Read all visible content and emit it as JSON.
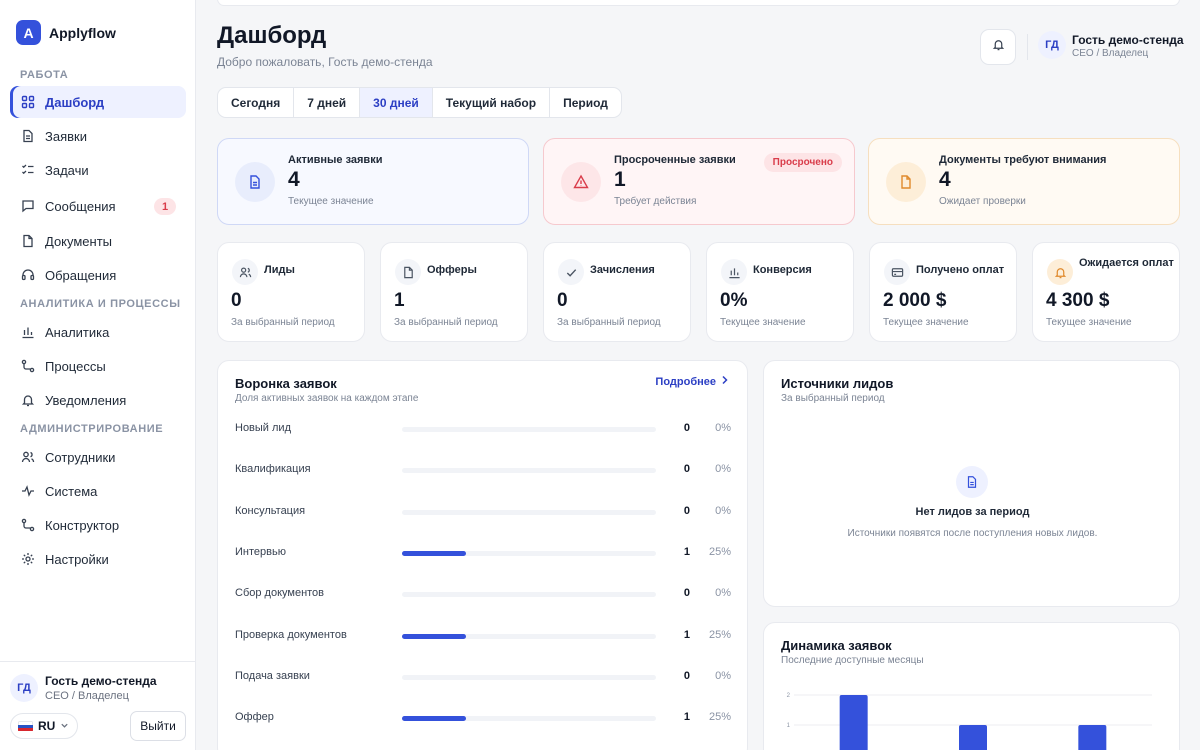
{
  "brand": {
    "logo_letter": "A",
    "name": "Applyflow"
  },
  "sidebar": {
    "sections": [
      {
        "title": "РАБОТА",
        "items": [
          {
            "label": "Дашборд",
            "icon": "grid-icon",
            "active": true
          },
          {
            "label": "Заявки",
            "icon": "file-icon"
          },
          {
            "label": "Задачи",
            "icon": "checklist-icon"
          },
          {
            "label": "Сообщения",
            "icon": "message-icon",
            "badge": "1"
          },
          {
            "label": "Документы",
            "icon": "document-icon"
          },
          {
            "label": "Обращения",
            "icon": "headset-icon"
          }
        ]
      },
      {
        "title": "АНАЛИТИКА И ПРОЦЕССЫ",
        "items": [
          {
            "label": "Аналитика",
            "icon": "bar-chart-icon"
          },
          {
            "label": "Процессы",
            "icon": "workflow-icon"
          },
          {
            "label": "Уведомления",
            "icon": "bell-icon"
          }
        ]
      },
      {
        "title": "АДМИНИСТРИРОВАНИЕ",
        "items": [
          {
            "label": "Сотрудники",
            "icon": "users-icon"
          },
          {
            "label": "Система",
            "icon": "activity-icon"
          },
          {
            "label": "Конструктор",
            "icon": "workflow-icon"
          },
          {
            "label": "Настройки",
            "icon": "gear-icon"
          }
        ]
      }
    ],
    "footer": {
      "avatar": "ГД",
      "name": "Гость демо-стенда",
      "role": "CEO / Владелец",
      "language": "RU",
      "logout": "Выйти"
    }
  },
  "header": {
    "title": "Дашборд",
    "subtitle": "Добро пожаловать, Гость демо-стенда",
    "user_avatar": "ГД",
    "user_name": "Гость демо-стенда",
    "user_role": "CEO / Владелец"
  },
  "period_tabs": [
    {
      "label": "Сегодня"
    },
    {
      "label": "7 дней"
    },
    {
      "label": "30 дней",
      "active": true
    },
    {
      "label": "Текущий набор"
    },
    {
      "label": "Период"
    }
  ],
  "alerts": [
    {
      "title": "Активные заявки",
      "value": "4",
      "sub": "Текущее значение",
      "icon": "file-icon",
      "tone": "blue"
    },
    {
      "title": "Просроченные заявки",
      "value": "1",
      "sub": "Требует действия",
      "icon": "warning-icon",
      "tone": "red",
      "badge": "Просрочено"
    },
    {
      "title": "Документы требуют внимания",
      "value": "4",
      "sub": "Ожидает проверки",
      "icon": "document-icon",
      "tone": "orange"
    }
  ],
  "metrics": [
    {
      "title": "Лиды",
      "value": "0",
      "sub": "За выбранный период",
      "icon": "users-icon"
    },
    {
      "title": "Офферы",
      "value": "1",
      "sub": "За выбранный период",
      "icon": "document-icon"
    },
    {
      "title": "Зачисления",
      "value": "0",
      "sub": "За выбранный период",
      "icon": "check-icon"
    },
    {
      "title": "Конверсия",
      "value": "0%",
      "sub": "Текущее значение",
      "icon": "bar-chart-icon"
    },
    {
      "title": "Получено оплат",
      "value": "2 000 $",
      "sub": "Текущее значение",
      "icon": "card-icon"
    },
    {
      "title": "Ожидается оплат",
      "value": "4 300 $",
      "sub": "Текущее значение",
      "icon": "bell-icon",
      "two_line": true
    }
  ],
  "funnel": {
    "title": "Воронка заявок",
    "subtitle": "Доля активных заявок на каждом этапе",
    "more": "Подробнее",
    "rows": [
      {
        "label": "Новый лид",
        "count": "0",
        "pct": "0%",
        "fraction": 0
      },
      {
        "label": "Квалификация",
        "count": "0",
        "pct": "0%",
        "fraction": 0
      },
      {
        "label": "Консультация",
        "count": "0",
        "pct": "0%",
        "fraction": 0
      },
      {
        "label": "Интервью",
        "count": "1",
        "pct": "25%",
        "fraction": 0.25
      },
      {
        "label": "Сбор документов",
        "count": "0",
        "pct": "0%",
        "fraction": 0
      },
      {
        "label": "Проверка документов",
        "count": "1",
        "pct": "25%",
        "fraction": 0.25
      },
      {
        "label": "Подача заявки",
        "count": "0",
        "pct": "0%",
        "fraction": 0
      },
      {
        "label": "Оффер",
        "count": "1",
        "pct": "25%",
        "fraction": 0.25
      }
    ]
  },
  "sources": {
    "title": "Источники лидов",
    "subtitle": "За выбранный период",
    "empty_title": "Нет лидов за период",
    "empty_sub": "Источники появятся после поступления новых лидов."
  },
  "dynamics": {
    "title": "Динамика заявок",
    "subtitle": "Последние доступные месяцы"
  },
  "chart_data": {
    "type": "bar",
    "values": [
      2,
      1,
      1
    ],
    "ylim": [
      0,
      2
    ],
    "yticks": [
      "2",
      "1"
    ],
    "grid": true,
    "color": "#3451db"
  },
  "colors": {
    "accent": "#3451db",
    "alert_red": "#d93c4a",
    "alert_orange": "#e08a2c"
  }
}
